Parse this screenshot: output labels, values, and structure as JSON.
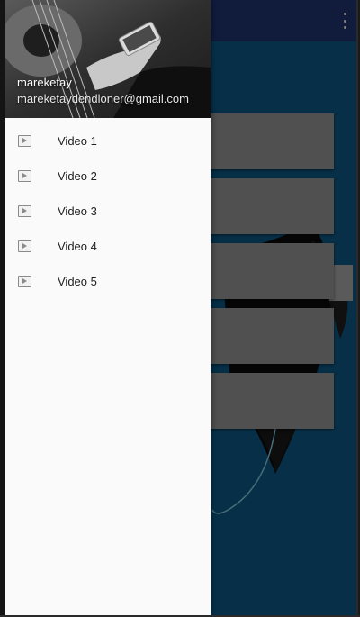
{
  "drawer": {
    "user_name": "mareketay",
    "user_email": "mareketaydendloner@gmail.com",
    "items": [
      {
        "label": "Video 1",
        "icon": "play-icon"
      },
      {
        "label": "Video 2",
        "icon": "play-icon"
      },
      {
        "label": "Video 3",
        "icon": "play-icon"
      },
      {
        "label": "Video 4",
        "icon": "play-icon"
      },
      {
        "label": "Video 5",
        "icon": "play-icon"
      }
    ]
  },
  "app_bar": {
    "menu_icon": "overflow-menu-icon",
    "color": "#1b2a5c"
  },
  "colors": {
    "drawer_bg": "#fafafa",
    "content_bg": "#0b4a6f",
    "card_bg": "#7b7b7b"
  }
}
